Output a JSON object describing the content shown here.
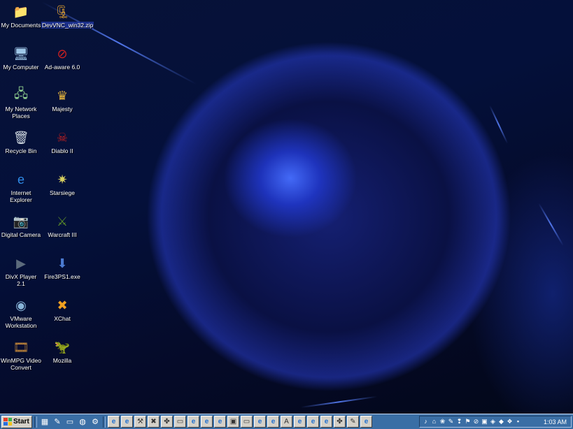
{
  "desktop": {
    "icons_col1": [
      {
        "label": "My Documents",
        "icon": "folder-documents-icon",
        "glyph": "📁",
        "color": "#f3d36a"
      },
      {
        "label": "My Computer",
        "icon": "computer-icon",
        "glyph": "🖥",
        "color": "#9fc7e8"
      },
      {
        "label": "My Network Places",
        "icon": "network-places-icon",
        "glyph": "🖧",
        "color": "#8fd08f"
      },
      {
        "label": "Recycle Bin",
        "icon": "recycle-bin-icon",
        "glyph": "🗑",
        "color": "#cfd8e0"
      },
      {
        "label": "Internet Explorer",
        "icon": "internet-explorer-icon",
        "glyph": "e",
        "color": "#2f8ae6"
      },
      {
        "label": "Digital Camera",
        "icon": "digital-camera-icon",
        "glyph": "📷",
        "color": "#4aa0e0"
      },
      {
        "label": "DivX Player 2.1",
        "icon": "divx-player-icon",
        "glyph": "▶",
        "color": "#5c6b7c"
      },
      {
        "label": "VMware Workstation",
        "icon": "vmware-icon",
        "glyph": "◉",
        "color": "#88b4d8"
      },
      {
        "label": "WinMPG Video Convert",
        "icon": "winmpg-icon",
        "glyph": "🎞",
        "color": "#c88a3a"
      }
    ],
    "icons_col2": [
      {
        "label": "DevVNC_win32.zip",
        "icon": "zip-archive-icon",
        "glyph": "🗜",
        "color": "#e0a030"
      },
      {
        "label": "Ad-aware 6.0",
        "icon": "ad-aware-icon",
        "glyph": "⊘",
        "color": "#d02020"
      },
      {
        "label": "Majesty",
        "icon": "majesty-icon",
        "glyph": "♛",
        "color": "#e3b23c"
      },
      {
        "label": "Diablo II",
        "icon": "diablo-icon",
        "glyph": "☠",
        "color": "#c02020"
      },
      {
        "label": "Starsiege",
        "icon": "starsiege-icon",
        "glyph": "✷",
        "color": "#d8d060"
      },
      {
        "label": "Warcraft III",
        "icon": "warcraft-icon",
        "glyph": "⚔",
        "color": "#5a8a2a"
      },
      {
        "label": "Fire3PS1.exe",
        "icon": "installer-icon",
        "glyph": "⬇",
        "color": "#4a7ad0"
      },
      {
        "label": "XChat",
        "icon": "xchat-icon",
        "glyph": "✖",
        "color": "#f0a020"
      },
      {
        "label": "Mozilla",
        "icon": "mozilla-icon",
        "glyph": "🦖",
        "color": "#c03020"
      }
    ]
  },
  "taskbar": {
    "start_label": "Start",
    "quick_launch": [
      {
        "icon": "show-desktop-icon",
        "glyph": "▦"
      },
      {
        "icon": "ql-app-icon",
        "glyph": "✎"
      },
      {
        "icon": "ql-drive-icon",
        "glyph": "▭"
      },
      {
        "icon": "ql-ie-icon",
        "glyph": "◍"
      },
      {
        "icon": "ql-tool-icon",
        "glyph": "⚙"
      }
    ],
    "task_buttons": [
      {
        "icon": "task-ie-icon",
        "glyph": "e"
      },
      {
        "icon": "task-ie-icon",
        "glyph": "e"
      },
      {
        "icon": "task-tool-icon",
        "glyph": "⚒"
      },
      {
        "icon": "task-xchat-icon",
        "glyph": "✖"
      },
      {
        "icon": "task-clover-icon",
        "glyph": "✤"
      },
      {
        "icon": "task-folder-icon",
        "glyph": "▭"
      },
      {
        "icon": "task-ie-icon",
        "glyph": "e"
      },
      {
        "icon": "task-ie-icon",
        "glyph": "e"
      },
      {
        "icon": "task-ie-icon",
        "glyph": "e"
      },
      {
        "icon": "task-app-icon",
        "glyph": "▣"
      },
      {
        "icon": "task-folder-icon",
        "glyph": "▭"
      },
      {
        "icon": "task-ie-icon",
        "glyph": "e"
      },
      {
        "icon": "task-ie-icon",
        "glyph": "e"
      },
      {
        "icon": "task-font-icon",
        "glyph": "A"
      },
      {
        "icon": "task-ie-icon",
        "glyph": "e"
      },
      {
        "icon": "task-ie-icon",
        "glyph": "e"
      },
      {
        "icon": "task-ie-icon",
        "glyph": "e"
      },
      {
        "icon": "task-clover-icon",
        "glyph": "✤"
      },
      {
        "icon": "task-paint-icon",
        "glyph": "✎"
      },
      {
        "icon": "task-ie-icon",
        "glyph": "e"
      }
    ],
    "tray_icons": [
      {
        "icon": "volume-icon",
        "glyph": "♪"
      },
      {
        "icon": "network-icon",
        "glyph": "⌂"
      },
      {
        "icon": "tray-app-icon",
        "glyph": "❀"
      },
      {
        "icon": "tray-pen-icon",
        "glyph": "✎"
      },
      {
        "icon": "tray-alert-icon",
        "glyph": "❢"
      },
      {
        "icon": "tray-flag-icon",
        "glyph": "⚑"
      },
      {
        "icon": "tray-adaware-icon",
        "glyph": "⊘"
      },
      {
        "icon": "tray-monitor-icon",
        "glyph": "▣"
      },
      {
        "icon": "tray-color-icon",
        "glyph": "◈"
      },
      {
        "icon": "tray-shield-icon",
        "glyph": "◆"
      },
      {
        "icon": "tray-vnc-icon",
        "glyph": "❖"
      },
      {
        "icon": "tray-display-icon",
        "glyph": "▪"
      }
    ],
    "clock": "1:03 AM"
  }
}
